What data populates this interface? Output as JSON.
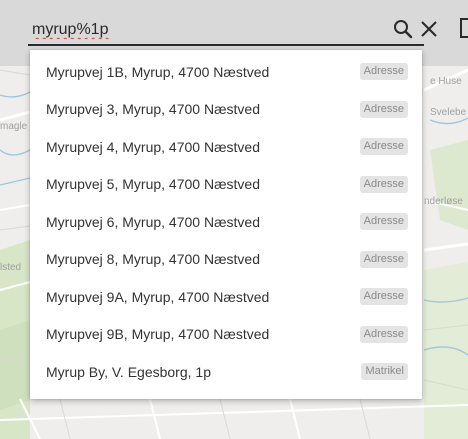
{
  "search": {
    "query": "myrup%1p"
  },
  "icons": {
    "search": "search-icon",
    "clear": "close-icon"
  },
  "results": [
    {
      "label": "Myrupvej 1B, Myrup, 4700 Næstved",
      "type": "Adresse"
    },
    {
      "label": "Myrupvej 3, Myrup, 4700 Næstved",
      "type": "Adresse"
    },
    {
      "label": "Myrupvej 4, Myrup, 4700 Næstved",
      "type": "Adresse"
    },
    {
      "label": "Myrupvej 5, Myrup, 4700 Næstved",
      "type": "Adresse"
    },
    {
      "label": "Myrupvej 6, Myrup, 4700 Næstved",
      "type": "Adresse"
    },
    {
      "label": "Myrupvej 8, Myrup, 4700 Næstved",
      "type": "Adresse"
    },
    {
      "label": "Myrupvej 9A, Myrup, 4700 Næstved",
      "type": "Adresse"
    },
    {
      "label": "Myrupvej 9B, Myrup, 4700 Næstved",
      "type": "Adresse"
    },
    {
      "label": "Myrup By, V. Egesborg, 1p",
      "type": "Matrikel"
    }
  ],
  "map": {
    "labels": [
      "magle",
      "lsted",
      "e Huse",
      "Svelebe",
      "nderløse"
    ]
  },
  "colors": {
    "topbar": "#d9d9d9",
    "map_bg": "#efeeec",
    "water": "#9fc6df",
    "badge_bg": "#e4e4e4",
    "spellcheck": "#e03c31"
  }
}
